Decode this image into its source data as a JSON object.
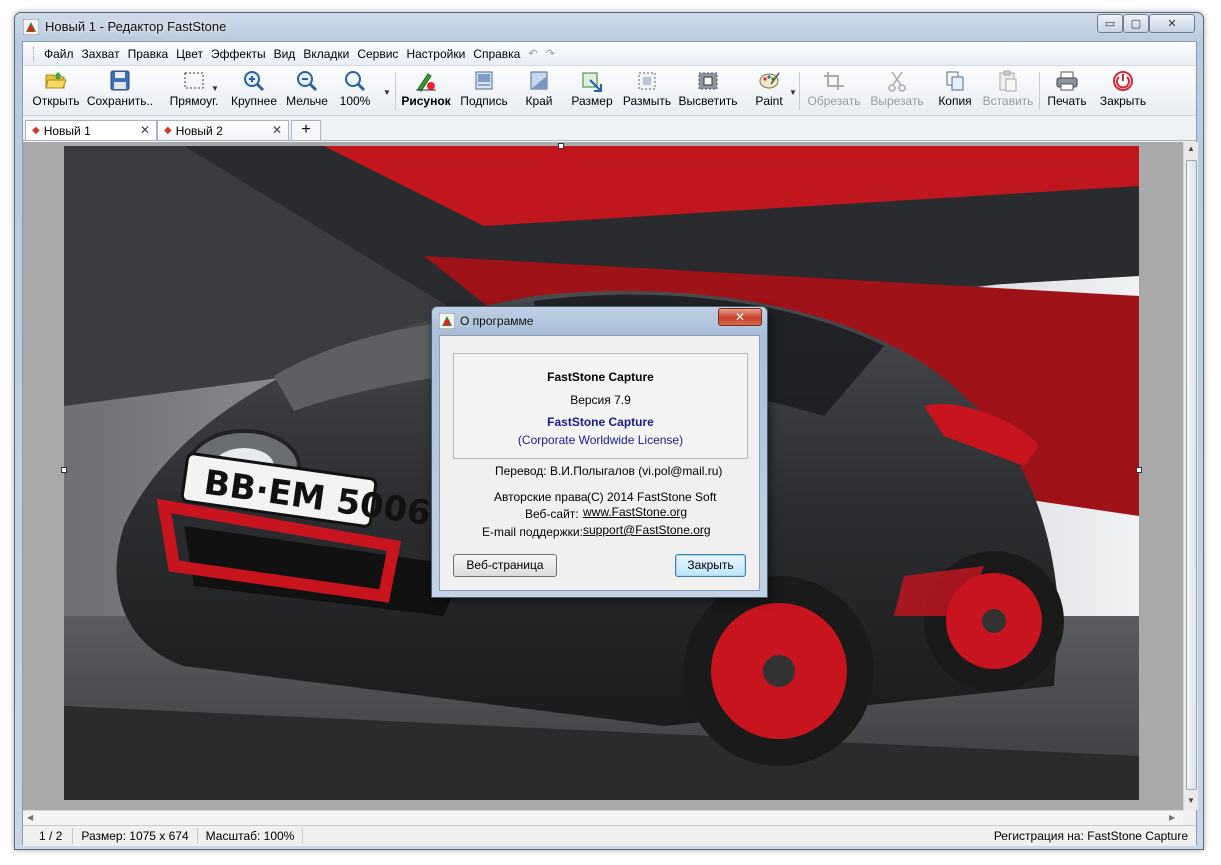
{
  "window": {
    "title": "Новый 1 - Редактор FastStone",
    "controls": {
      "minimize": "▭",
      "maximize": "▢",
      "close": "✕"
    }
  },
  "menu": {
    "items": [
      "Файл",
      "Захват",
      "Правка",
      "Цвет",
      "Эффекты",
      "Вид",
      "Вкладки",
      "Сервис",
      "Настройки",
      "Справка"
    ],
    "undo": "↶",
    "redo": "↷"
  },
  "toolbar": {
    "open": "Открыть",
    "save": "Сохранить..",
    "rect": "Прямоуг.",
    "zoom_in": "Крупнее",
    "zoom_out": "Мельче",
    "zoom_100": "100%",
    "draw": "Рисунок",
    "caption": "Подпись",
    "edge": "Край",
    "resize": "Размер",
    "blur": "Размыть",
    "spotlight": "Высветить",
    "paint": "Paint",
    "crop": "Обрезать",
    "cut": "Вырезать",
    "copy": "Копия",
    "paste": "Вставить",
    "print": "Печать",
    "close": "Закрыть"
  },
  "tabs": [
    {
      "label": "Новый 1",
      "close": "✕"
    },
    {
      "label": "Новый 2",
      "close": "✕"
    }
  ],
  "tab_add": "+",
  "status": {
    "page": "1 / 2",
    "size": "Размер: 1075 x 674",
    "scale": "Масштаб: 100%",
    "registration": "Регистрация на: FastStone Capture"
  },
  "dialog": {
    "title": "О программе",
    "close": "✕",
    "product": "FastStone Capture",
    "version": "Версия 7.9",
    "product_link": "FastStone Capture",
    "license": "(Corporate Worldwide License)",
    "translation": "Перевод: В.И.Полыгалов (vi.pol@mail.ru)",
    "copyright_label": "Авторские права",
    "copyright_value": "(C) 2014 FastStone Soft",
    "website_label": "Веб-сайт:",
    "website_value": "www.FastStone.org",
    "email_label": "E-mail поддержки:",
    "email_value": "support@FastStone.org",
    "web_button": "Веб-страница",
    "close_button": "Закрыть"
  },
  "photo": {
    "plate": "BB·EM 5006"
  },
  "colors": {
    "link_blue": "#1a1a8c",
    "car_red": "#c8141e",
    "tab_dot": "#d13a2a"
  }
}
